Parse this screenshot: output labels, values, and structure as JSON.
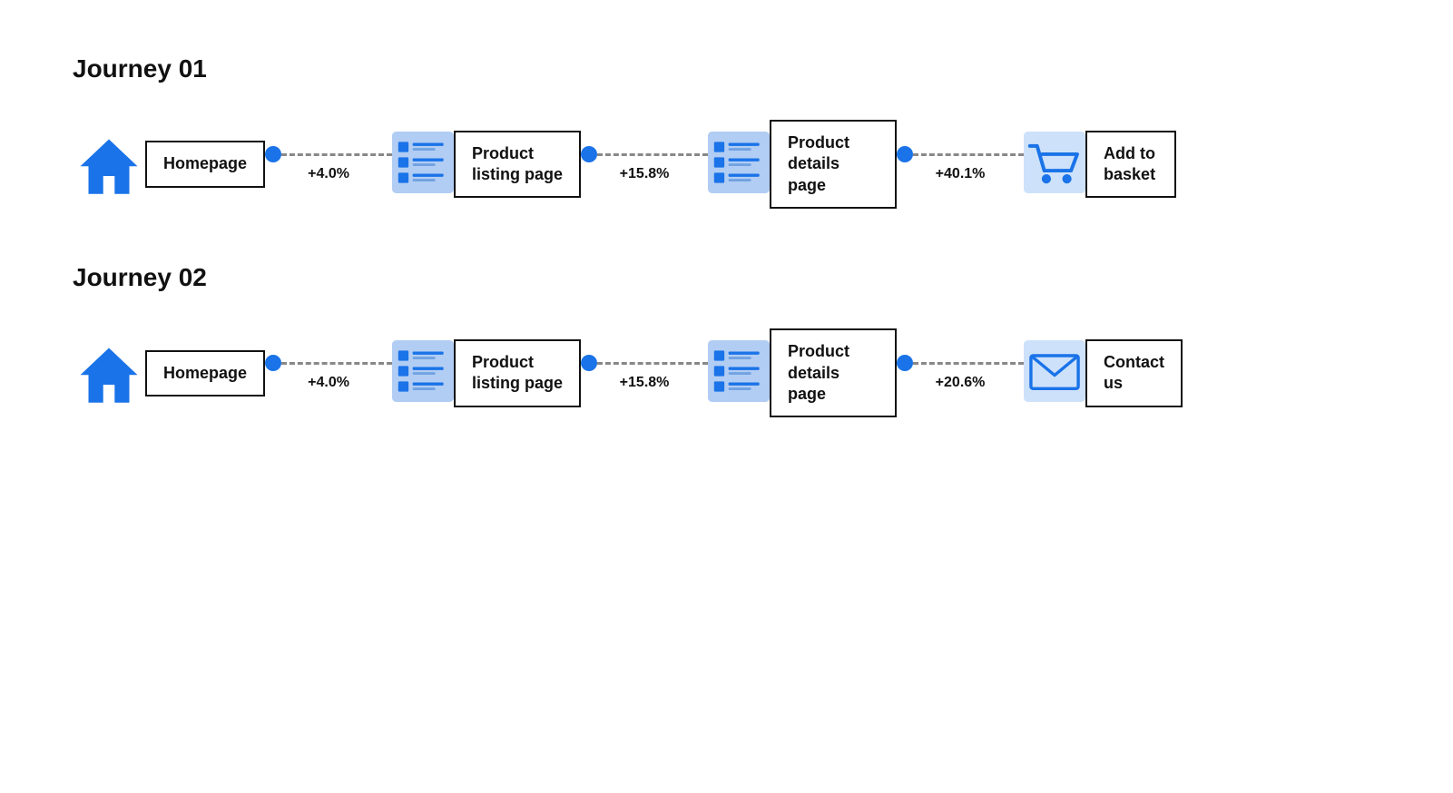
{
  "journeys": [
    {
      "id": "journey-01",
      "title": "Journey 01",
      "steps": [
        {
          "id": "homepage",
          "label": "Homepage",
          "icon": "home",
          "multiline": false
        },
        {
          "id": "product-listing",
          "label": "Product\nlisting page",
          "icon": "list",
          "multiline": true
        },
        {
          "id": "product-details",
          "label": "Product\ndetails page",
          "icon": "list",
          "multiline": true
        },
        {
          "id": "add-to-basket",
          "label": "Add to\nbasket",
          "icon": "cart",
          "multiline": true
        }
      ],
      "connectors": [
        {
          "pct": "+4.0%"
        },
        {
          "pct": "+15.8%"
        },
        {
          "pct": "+40.1%"
        }
      ]
    },
    {
      "id": "journey-02",
      "title": "Journey 02",
      "steps": [
        {
          "id": "homepage",
          "label": "Homepage",
          "icon": "home",
          "multiline": false
        },
        {
          "id": "product-listing",
          "label": "Product\nlisting page",
          "icon": "list",
          "multiline": true
        },
        {
          "id": "product-details",
          "label": "Product\ndetails page",
          "icon": "list",
          "multiline": true
        },
        {
          "id": "contact-us",
          "label": "Contact\nus",
          "icon": "email",
          "multiline": true
        }
      ],
      "connectors": [
        {
          "pct": "+4.0%"
        },
        {
          "pct": "+15.8%"
        },
        {
          "pct": "+20.6%"
        }
      ]
    }
  ]
}
